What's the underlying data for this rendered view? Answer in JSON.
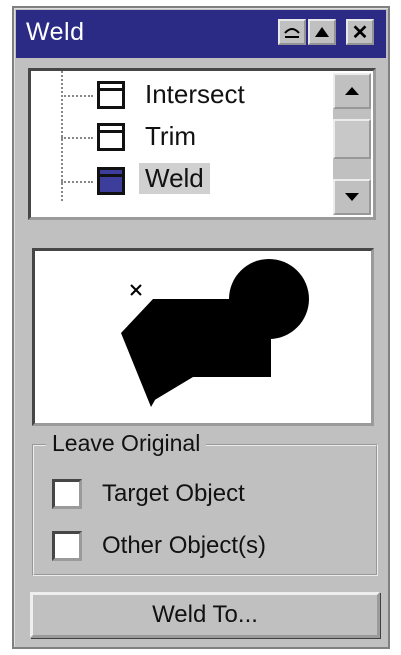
{
  "window": {
    "title": "Weld",
    "controls": [
      "rollup-icon",
      "collapse-up-icon",
      "close-icon"
    ]
  },
  "tree": {
    "items": [
      {
        "label": "Intersect",
        "icon": "shaping-window-icon",
        "selected": false
      },
      {
        "label": "Trim",
        "icon": "shaping-window-icon",
        "selected": false
      },
      {
        "label": "Weld",
        "icon": "shaping-window-icon",
        "selected": true
      }
    ]
  },
  "preview": {
    "icon": "weld-preview-illustration"
  },
  "leave_original": {
    "legend": "Leave Original",
    "options": [
      {
        "label": "Target Object",
        "checked": false
      },
      {
        "label": "Other Object(s)",
        "checked": false
      }
    ]
  },
  "action": {
    "weld_to_label": "Weld To..."
  },
  "colors": {
    "titlebar": "#2b2b86",
    "panel": "#c0c0c0",
    "selected_icon": "#3d3d9c"
  }
}
